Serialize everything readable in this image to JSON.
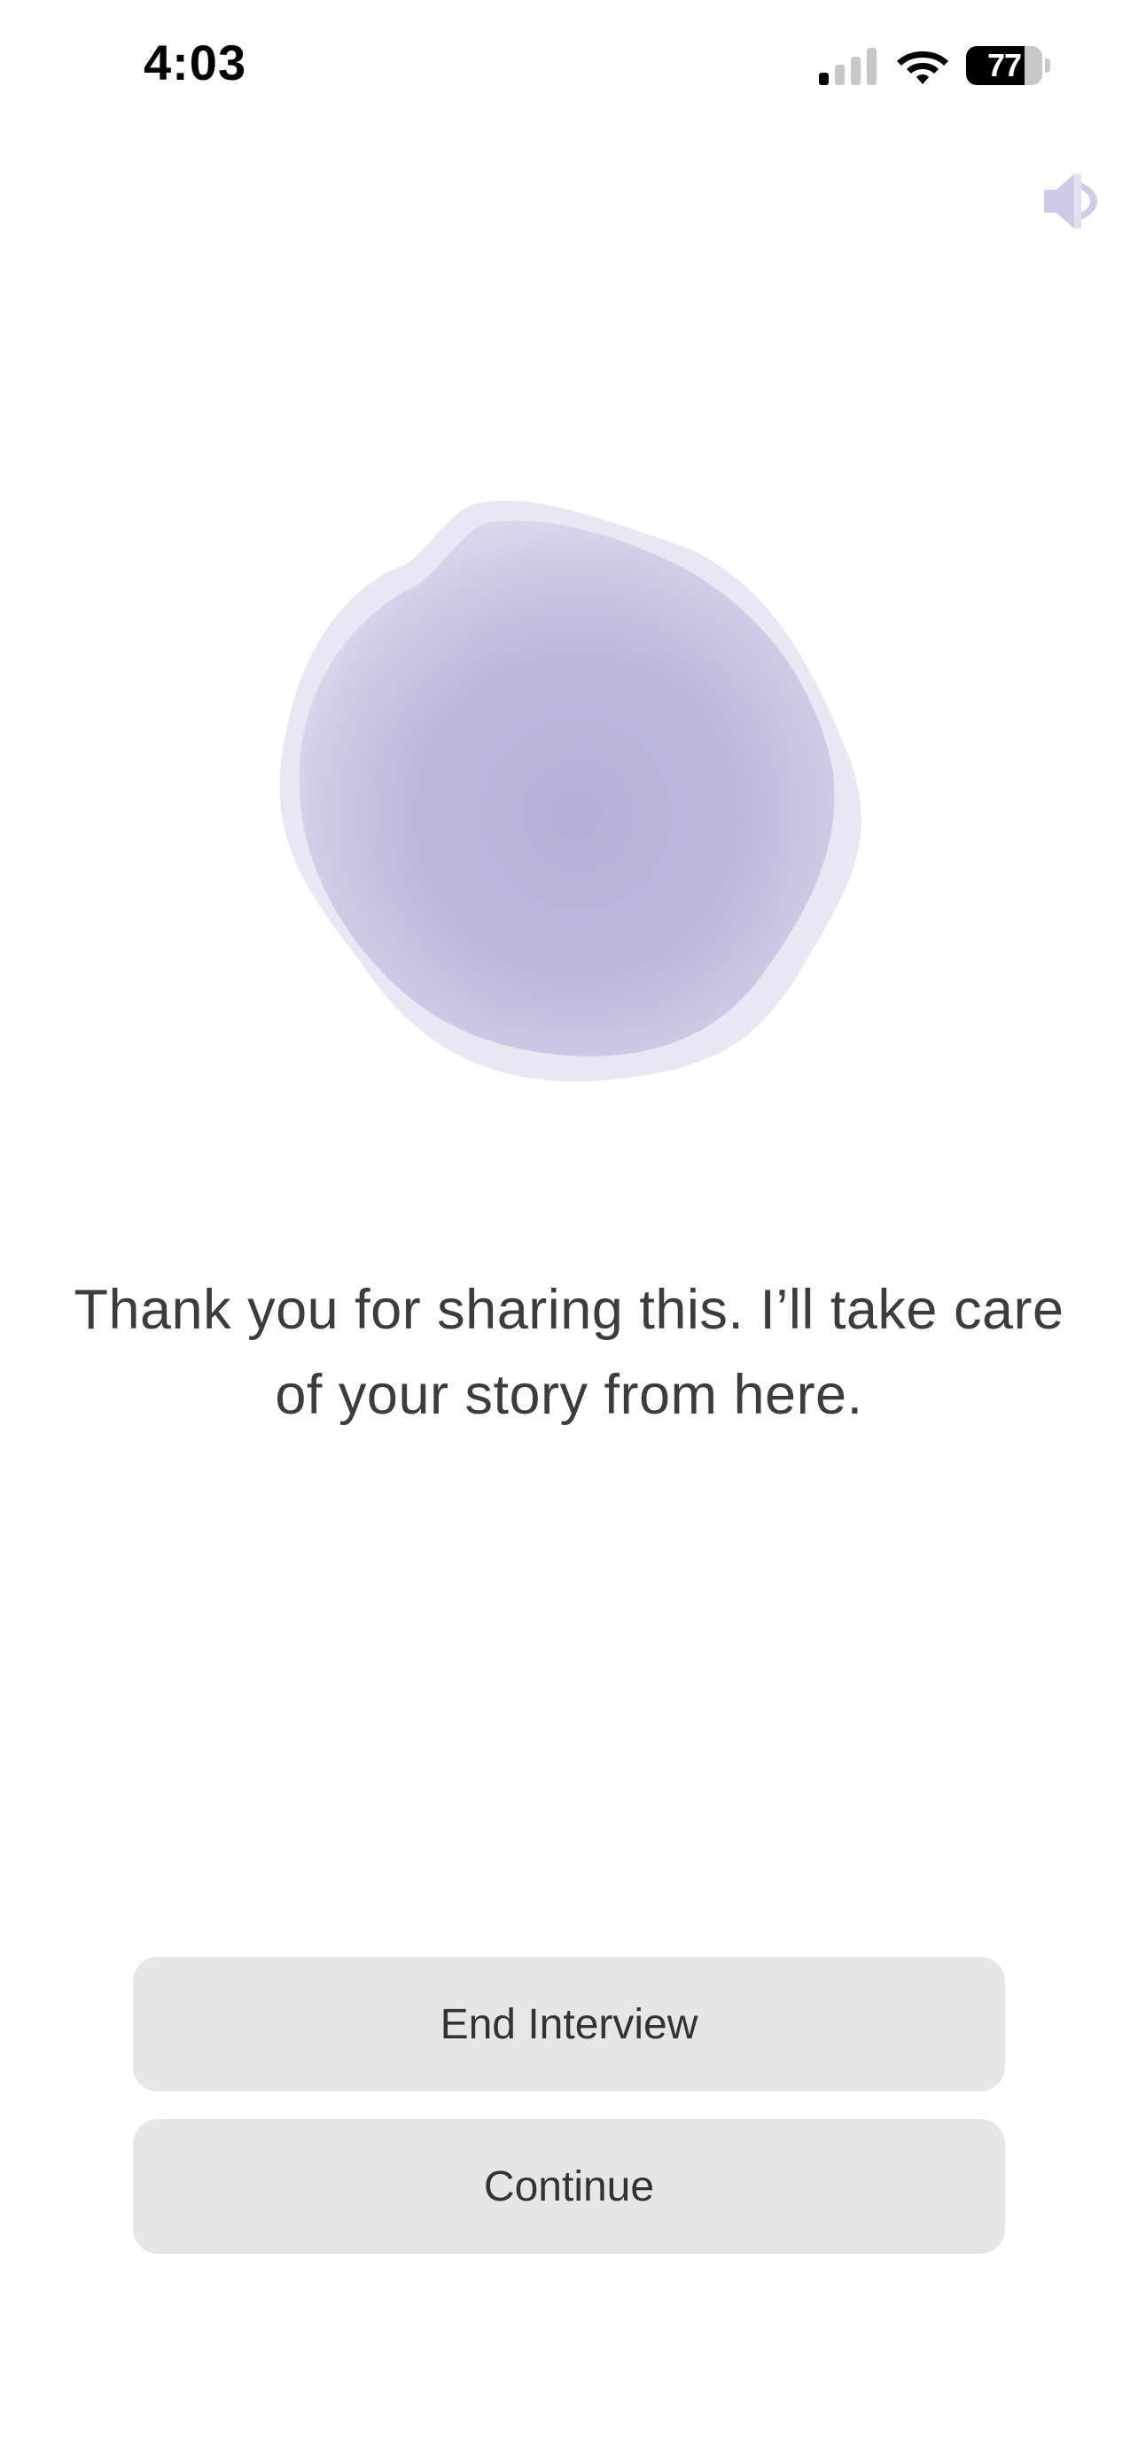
{
  "status_bar": {
    "time": "4:03",
    "battery_level": "77",
    "battery_fraction": 0.77,
    "signal_bars_active": 1,
    "signal_bars_total": 4
  },
  "icons": {
    "speaker": "speaker-icon",
    "wifi": "wifi-icon",
    "signal": "cellular-signal-icon",
    "battery": "battery-icon"
  },
  "colors": {
    "orb": "#b8b3d8",
    "orb_edge": "#e6e3f2",
    "speaker": "#cfcbe6",
    "button_bg": "#e6e6e6",
    "text": "#3c3c3e"
  },
  "message": {
    "text": "Thank you for sharing this. I’ll take care of your story from here."
  },
  "actions": {
    "end_label": "End Interview",
    "continue_label": "Continue"
  }
}
